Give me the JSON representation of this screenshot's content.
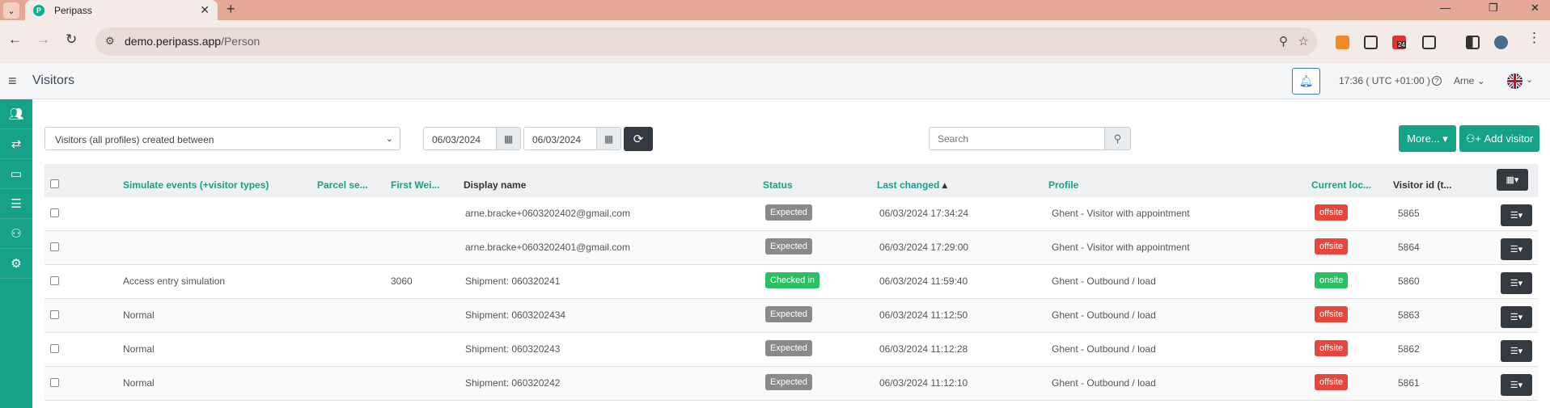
{
  "browser": {
    "tab_title": "Peripass",
    "tab_close": "✕",
    "new_tab": "+",
    "url_host": "demo.peripass.app",
    "url_path": "/Person",
    "ext_badge": "24",
    "window_controls": [
      "—",
      "❐",
      "✕"
    ]
  },
  "app": {
    "title": "Visitors",
    "clock": "17:36 ( UTC +01:00 )",
    "help": "?",
    "user": "Arne"
  },
  "sidebar": {
    "icons": [
      "users-icon",
      "transfer-icon",
      "desk-icon",
      "checklist-icon",
      "user-settings-icon",
      "gears-icon"
    ]
  },
  "filter": {
    "select_value": "Visitors (all profiles) created between",
    "date_from": "06/03/2024",
    "date_to": "06/03/2024",
    "search_placeholder": "Search",
    "more_label": "More...",
    "add_label": "Add visitor"
  },
  "table": {
    "headers": {
      "simulate": "Simulate events (+visitor types)",
      "parcel": "Parcel se...",
      "first_weight": "First Wei...",
      "display_name": "Display name",
      "status": "Status",
      "last_changed": "Last changed",
      "sort_indicator": "▴",
      "profile": "Profile",
      "current_location": "Current loc...",
      "visitor_id": "Visitor id (t..."
    },
    "rows": [
      {
        "simulate": "",
        "parcel": "",
        "first_weight": "",
        "display_name": "arne.bracke+0603202402@gmail.com",
        "status": "Expected",
        "last_changed": "06/03/2024 17:34:24",
        "profile": "Ghent - Visitor with appointment",
        "location": "offsite",
        "visitor_id": "5865"
      },
      {
        "simulate": "",
        "parcel": "",
        "first_weight": "",
        "display_name": "arne.bracke+0603202401@gmail.com",
        "status": "Expected",
        "last_changed": "06/03/2024 17:29:00",
        "profile": "Ghent - Visitor with appointment",
        "location": "offsite",
        "visitor_id": "5864"
      },
      {
        "simulate": "Access entry simulation",
        "parcel": "",
        "first_weight": "3060",
        "display_name": "Shipment: 060320241",
        "status": "Checked in",
        "last_changed": "06/03/2024 11:59:40",
        "profile": "Ghent - Outbound / load",
        "location": "onsite",
        "visitor_id": "5860"
      },
      {
        "simulate": "Normal",
        "parcel": "",
        "first_weight": "",
        "display_name": "Shipment: 0603202434",
        "status": "Expected",
        "last_changed": "06/03/2024 11:12:50",
        "profile": "Ghent - Outbound / load",
        "location": "offsite",
        "visitor_id": "5863"
      },
      {
        "simulate": "Normal",
        "parcel": "",
        "first_weight": "",
        "display_name": "Shipment: 060320243",
        "status": "Expected",
        "last_changed": "06/03/2024 11:12:28",
        "profile": "Ghent - Outbound / load",
        "location": "offsite",
        "visitor_id": "5862"
      },
      {
        "simulate": "Normal",
        "parcel": "",
        "first_weight": "",
        "display_name": "Shipment: 060320242",
        "status": "Expected",
        "last_changed": "06/03/2024 11:12:10",
        "profile": "Ghent - Outbound / load",
        "location": "offsite",
        "visitor_id": "5861"
      }
    ]
  },
  "colors": {
    "accent": "#15a286",
    "expected": "#8a8a8a",
    "checked_in": "#28c060",
    "offsite": "#e8453c",
    "onsite": "#28c060"
  }
}
